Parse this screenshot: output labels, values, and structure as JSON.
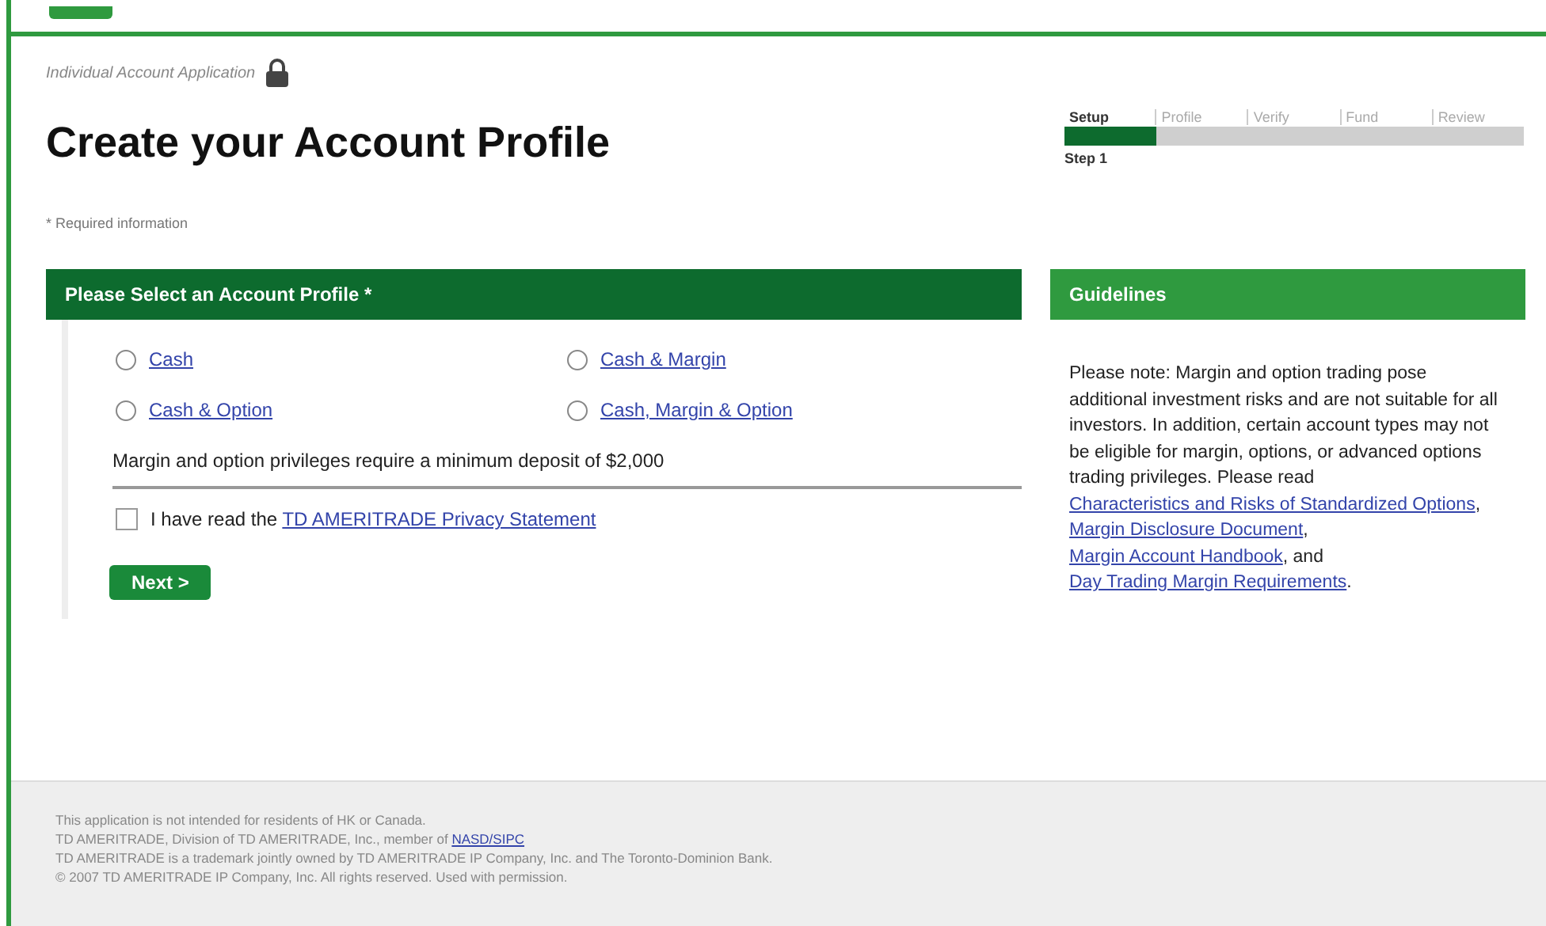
{
  "breadcrumb": {
    "text": "Individual Account Application"
  },
  "title": "Create your Account Profile",
  "required_note": "* Required information",
  "steps": [
    {
      "label": "Setup",
      "selected": true
    },
    {
      "label": "Profile",
      "selected": false
    },
    {
      "label": "Verify",
      "selected": false
    },
    {
      "label": "Fund",
      "selected": false
    },
    {
      "label": "Review",
      "selected": false
    }
  ],
  "progress": {
    "level": 0.2,
    "caption": "Step 1"
  },
  "profile_section": {
    "header": "Please Select an Account Profile *",
    "options": [
      {
        "label": "Cash",
        "selected": false
      },
      {
        "label": "Cash & Margin",
        "selected": false
      },
      {
        "label": "Cash & Option",
        "selected": false
      },
      {
        "label": "Cash, Margin & Option",
        "selected": false
      }
    ],
    "note": "Margin and option privileges require a minimum deposit of $2,000",
    "agreement": {
      "text": "I have read the ",
      "link": "TD AMERITRADE Privacy Statement",
      "checked": false
    },
    "next_button": "Next >"
  },
  "guidelines": {
    "header": "Guidelines",
    "segments": [
      {
        "text": "Please note: Margin and option trading pose additional investment risks and are not suitable for all investors. In addition, certain account types may not be eligible for margin, options, or advanced options trading privileges. Please read ",
        "kind": "text"
      },
      {
        "text": "Characteristics and Risks of Standardized Options",
        "kind": "link"
      },
      {
        "text": ", ",
        "kind": "text"
      },
      {
        "text": "Margin Disclosure Document",
        "kind": "link"
      },
      {
        "text": ", ",
        "kind": "text"
      },
      {
        "text": "Margin Account Handbook",
        "kind": "link"
      },
      {
        "text": ", and ",
        "kind": "text"
      },
      {
        "text": "Day Trading Margin Requirements",
        "kind": "link"
      },
      {
        "text": ".",
        "kind": "text"
      }
    ]
  },
  "footer": {
    "lines": [
      {
        "text": "This application is not intended for residents of HK or Canada."
      },
      {
        "text": "TD AMERITRADE, Division of TD AMERITRADE, Inc., member of ",
        "link": "NASD/SIPC"
      },
      {
        "text": "TD AMERITRADE is a trademark jointly owned by TD AMERITRADE IP Company, Inc. and The Toronto-Dominion Bank."
      },
      {
        "text": "© 2007 TD AMERITRADE IP Company, Inc. All rights reserved. Used with permission."
      }
    ]
  }
}
